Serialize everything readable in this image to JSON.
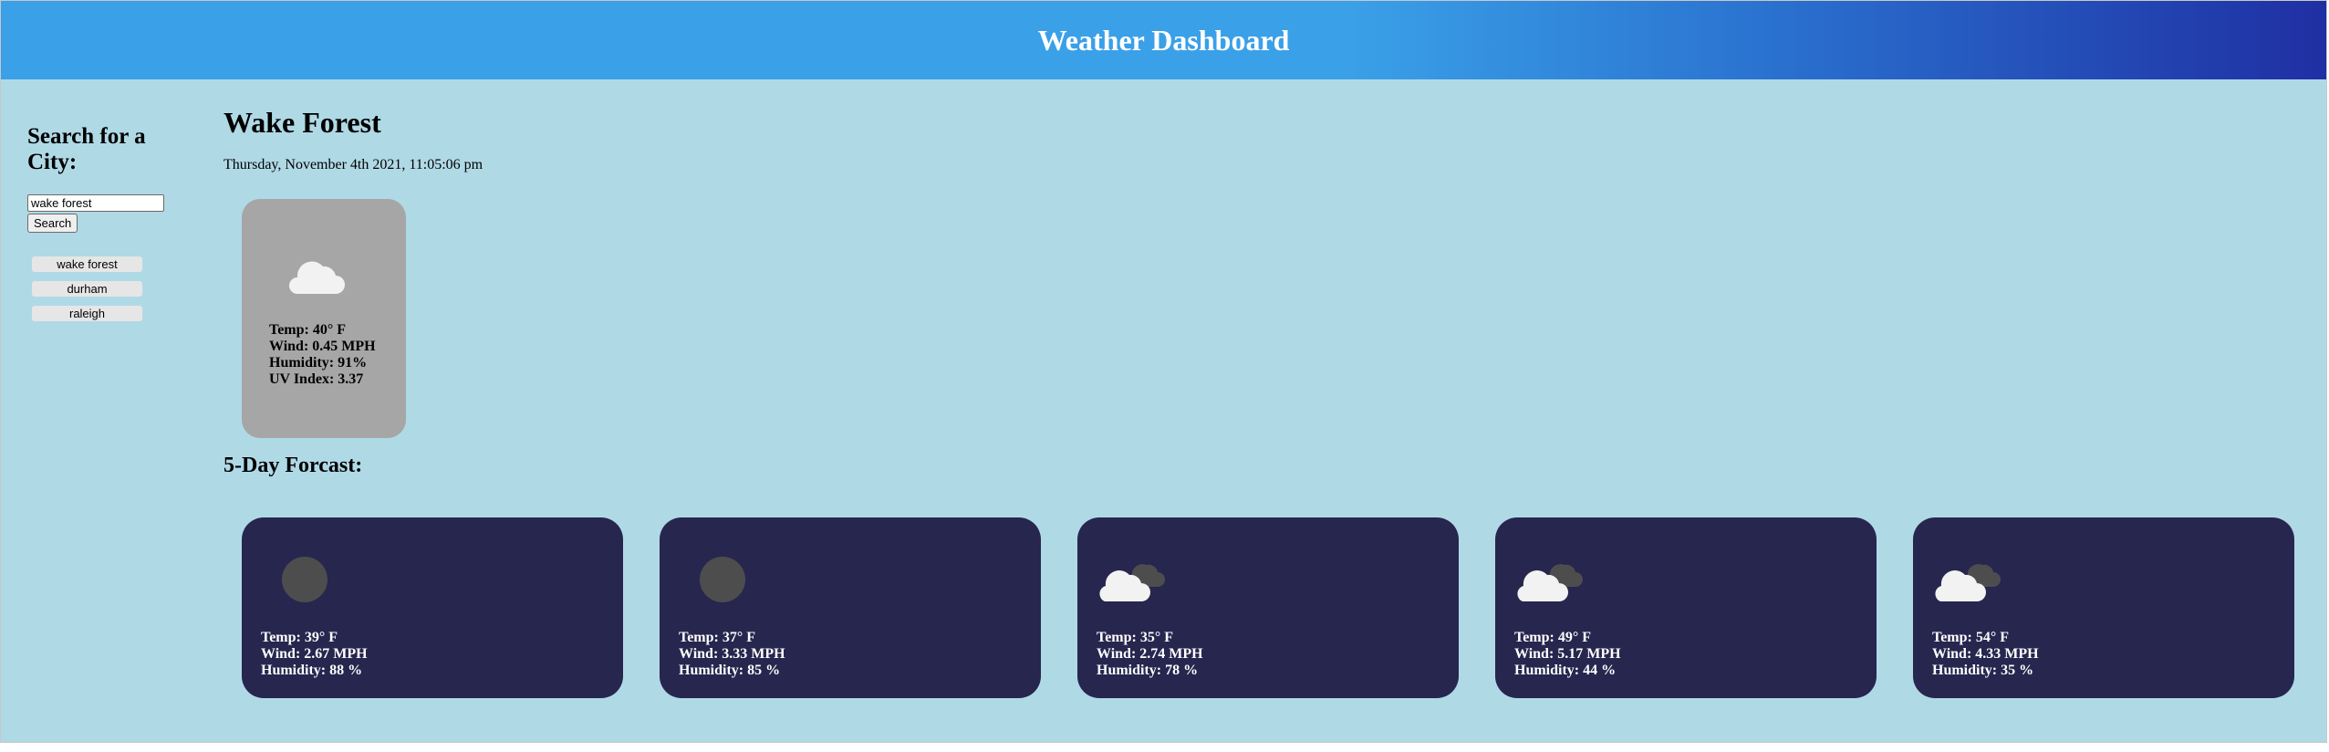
{
  "header": {
    "title": "Weather Dashboard"
  },
  "sidebar": {
    "heading": "Search for a City:",
    "search_value": "wake forest",
    "search_button": "Search",
    "history": [
      "wake forest",
      "durham",
      "raleigh"
    ]
  },
  "current": {
    "city": "Wake Forest",
    "date": "Thursday, November 4th 2021, 11:05:06 pm",
    "icon": "cloud-icon",
    "temp": "Temp: 40° F",
    "wind": "Wind: 0.45 MPH",
    "humidity": "Humidity: 91%",
    "uv": "UV Index: 3.37"
  },
  "forecast": {
    "title": "5-Day Forcast:",
    "days": [
      {
        "icon": "moon-icon",
        "temp": "Temp: 39° F",
        "wind": "Wind: 2.67 MPH",
        "humidity": "Humidity: 88 %"
      },
      {
        "icon": "moon-icon",
        "temp": "Temp: 37° F",
        "wind": "Wind: 3.33 MPH",
        "humidity": "Humidity: 85 %"
      },
      {
        "icon": "clouds-icon",
        "temp": "Temp: 35° F",
        "wind": "Wind: 2.74 MPH",
        "humidity": "Humidity: 78 %"
      },
      {
        "icon": "clouds-icon",
        "temp": "Temp: 49° F",
        "wind": "Wind: 5.17 MPH",
        "humidity": "Humidity: 44 %"
      },
      {
        "icon": "clouds-icon",
        "temp": "Temp: 54° F",
        "wind": "Wind: 4.33 MPH",
        "humidity": "Humidity: 35 %"
      }
    ]
  },
  "colors": {
    "page_background": "#b0d9e6",
    "header_gradient_start": "#3aa0e8",
    "header_gradient_end": "#1f2fa3",
    "current_card": "#a6a6a6",
    "forecast_card": "#27264f"
  }
}
